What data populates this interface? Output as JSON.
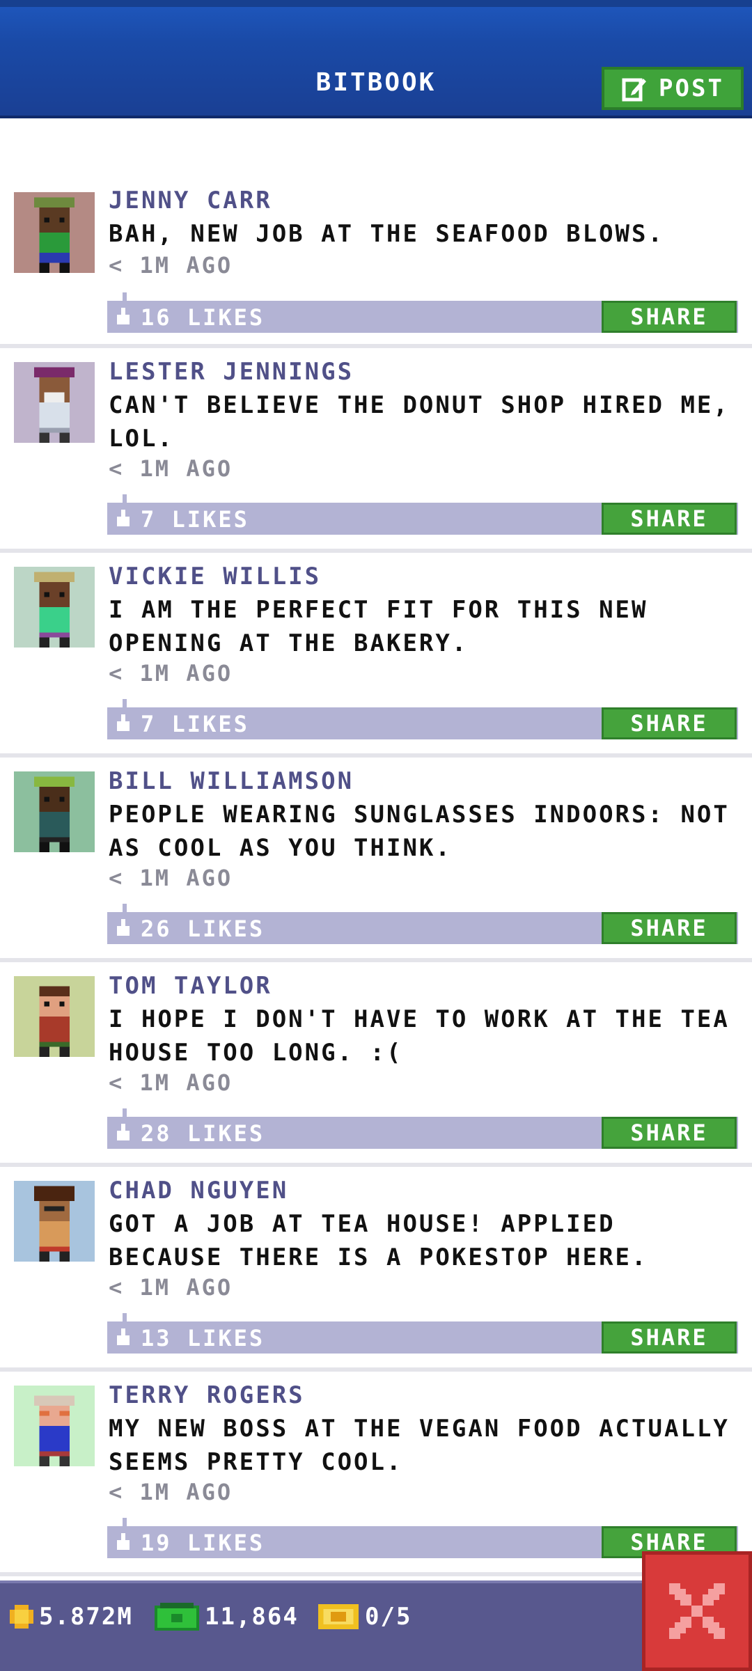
{
  "header": {
    "title": "BITBOOK",
    "post_label": "POST"
  },
  "posts": [
    {
      "name": "JENNY CARR",
      "message": "BAH, NEW JOB AT THE SEAFOOD BLOWS.",
      "time": "< 1M AGO",
      "likes": "16 LIKES",
      "share": "SHARE"
    },
    {
      "name": "LESTER JENNINGS",
      "message": "CAN'T BELIEVE THE DONUT SHOP HIRED ME, LOL.",
      "time": "< 1M AGO",
      "likes": "7 LIKES",
      "share": "SHARE"
    },
    {
      "name": "VICKIE WILLIS",
      "message": "I AM THE PERFECT FIT FOR THIS NEW OPENING AT THE BAKERY.",
      "time": "< 1M AGO",
      "likes": "7 LIKES",
      "share": "SHARE"
    },
    {
      "name": "BILL WILLIAMSON",
      "message": "PEOPLE WEARING SUNGLASSES INDOORS: NOT AS COOL AS YOU THINK.",
      "time": "< 1M AGO",
      "likes": "26 LIKES",
      "share": "SHARE"
    },
    {
      "name": "TOM TAYLOR",
      "message": "I HOPE I DON'T HAVE TO WORK AT THE TEA HOUSE TOO LONG. :(",
      "time": "< 1M AGO",
      "likes": "28 LIKES",
      "share": "SHARE"
    },
    {
      "name": "CHAD NGUYEN",
      "message": "GOT A JOB AT TEA HOUSE! APPLIED BECAUSE THERE IS A POKESTOP HERE.",
      "time": "< 1M AGO",
      "likes": "13 LIKES",
      "share": "SHARE"
    },
    {
      "name": "TERRY ROGERS",
      "message": "MY NEW BOSS AT THE VEGAN FOOD ACTUALLY SEEMS PRETTY COOL.",
      "time": "< 1M AGO",
      "likes": "19 LIKES",
      "share": "SHARE"
    }
  ],
  "footer": {
    "coins": "5.872M",
    "bux": "11,864",
    "tickets": "0/5"
  }
}
